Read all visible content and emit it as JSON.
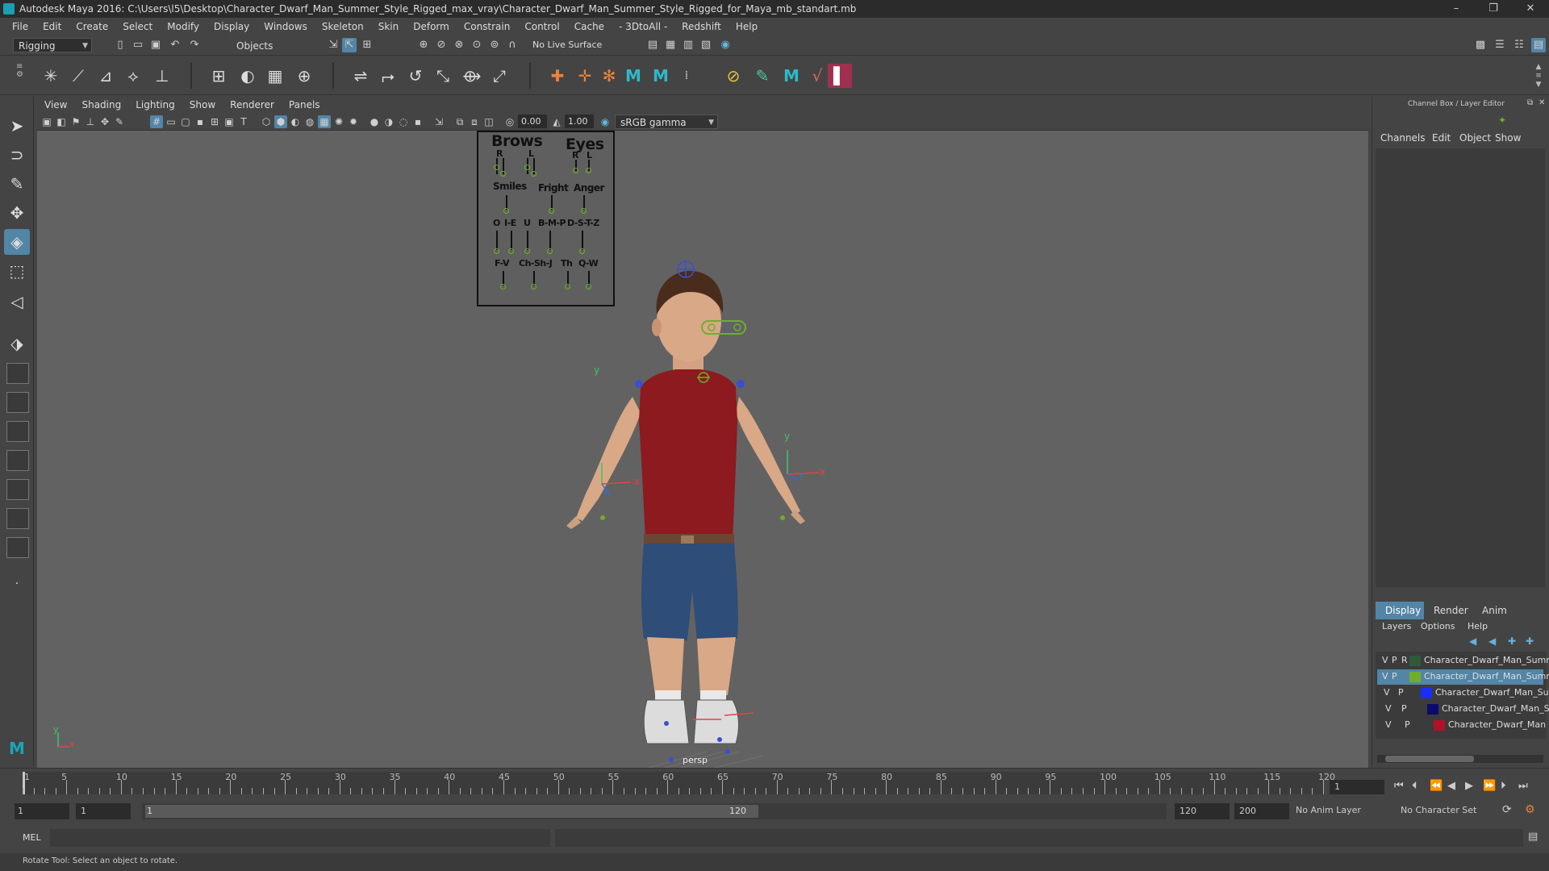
{
  "window": {
    "title": "Autodesk Maya 2016: C:\\Users\\l5\\Desktop\\Character_Dwarf_Man_Summer_Style_Rigged_max_vray\\Character_Dwarf_Man_Summer_Style_Rigged_for_Maya_mb_standart.mb",
    "controls": {
      "minimize": "–",
      "maximize": "❐",
      "close": "✕"
    }
  },
  "menubar": [
    "File",
    "Edit",
    "Create",
    "Select",
    "Modify",
    "Display",
    "Windows",
    "Skeleton",
    "Skin",
    "Deform",
    "Constrain",
    "Control",
    "Cache",
    "- 3DtoAll -",
    "Redshift",
    "Help"
  ],
  "statusline": {
    "menuset": "Rigging",
    "selection_mode": "Objects",
    "live_surface": "No Live Surface"
  },
  "viewport": {
    "menu": [
      "View",
      "Shading",
      "Lighting",
      "Show",
      "Renderer",
      "Panels"
    ],
    "exposure": "0.00",
    "gamma": "1.00",
    "color_space": "sRGB gamma",
    "camera_label": "persp"
  },
  "face_board": {
    "brows": "Brows",
    "eyes": "Eyes",
    "brows_r": "R",
    "brows_l": "L",
    "eyes_r": "R",
    "eyes_l": "L",
    "smiles": "Smiles",
    "fright": "Fright",
    "anger": "Anger",
    "o": "O",
    "ie": "I-E",
    "u": "U",
    "bmp": "B-M-P",
    "dstz": "D-S-T-Z",
    "fv": "F-V",
    "chshj": "Ch-Sh-J",
    "th": "Th",
    "qw": "Q-W"
  },
  "manip_axes": {
    "x": "x",
    "y": "y",
    "z": "z"
  },
  "channel_box": {
    "header": "Channel Box / Layer Editor",
    "tabs": [
      "Channels",
      "Edit",
      "Object",
      "Show"
    ]
  },
  "layer_editor": {
    "tabs": [
      "Display",
      "Render",
      "Anim"
    ],
    "menu": [
      "Layers",
      "Options",
      "Help"
    ],
    "layers": [
      {
        "v": "V",
        "p": "P",
        "r": "R",
        "name": "Character_Dwarf_Man_Summ",
        "color": "#2f5a3a",
        "selected": false
      },
      {
        "v": "V",
        "p": "P",
        "r": "",
        "name": "Character_Dwarf_Man_Summ",
        "color": "#6fae2c",
        "selected": true
      },
      {
        "v": "V",
        "p": "P",
        "r": "",
        "name": "Character_Dwarf_Man_Su",
        "color": "#1a2dff",
        "selected": false
      },
      {
        "v": "V",
        "p": "P",
        "r": "",
        "name": "Character_Dwarf_Man_S",
        "color": "#0b0b6e",
        "selected": false
      },
      {
        "v": "V",
        "p": "P",
        "r": "",
        "name": "Character_Dwarf_Man",
        "color": "#b01228",
        "selected": false
      }
    ]
  },
  "timeline": {
    "labels": [
      "1",
      "5",
      "10",
      "15",
      "20",
      "25",
      "30",
      "35",
      "40",
      "45",
      "50",
      "55",
      "60",
      "65",
      "70",
      "75",
      "80",
      "85",
      "90",
      "95",
      "100",
      "105",
      "110",
      "115",
      "120"
    ],
    "current_frame": "1"
  },
  "range": {
    "start": "1",
    "start_inner": "1",
    "slider_start": "1",
    "slider_end": "120",
    "end": "120",
    "end_outer": "200",
    "anim_layer": "No Anim Layer",
    "char_set": "No Character Set"
  },
  "command": {
    "lang": "MEL"
  },
  "help_line": "Rotate Tool: Select an object to rotate.",
  "colors": {
    "accent": "#5285a6",
    "control_green": "#6fae2c"
  }
}
